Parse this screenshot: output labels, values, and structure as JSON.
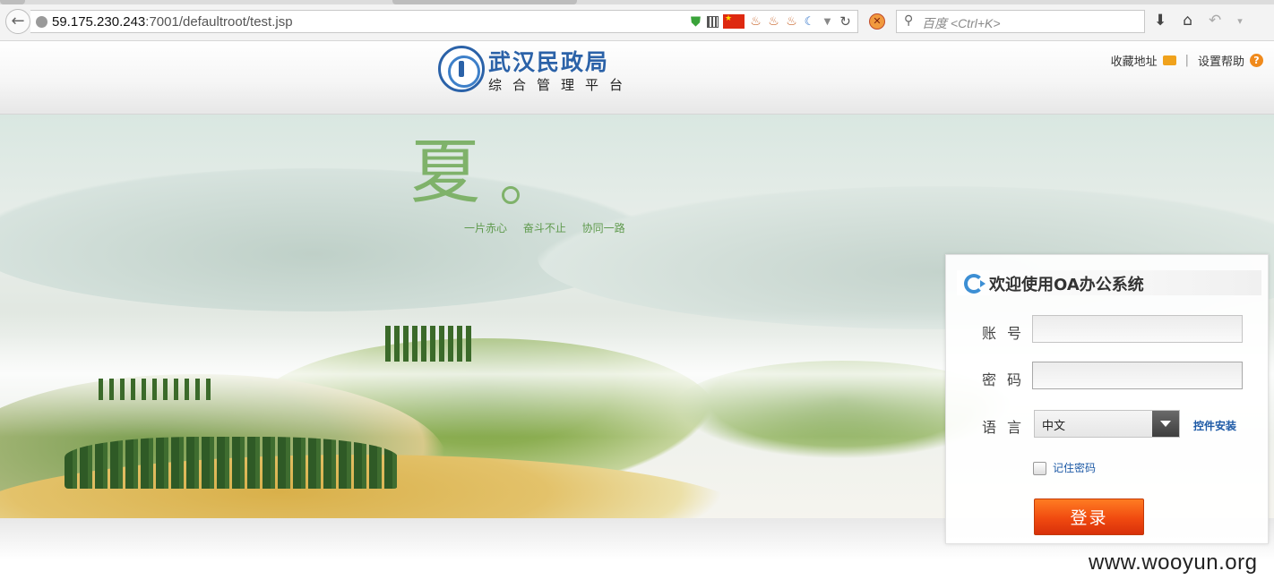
{
  "browser": {
    "url_host": "59.175.230.243",
    "url_rest": ":7001/defaultroot/test.jsp",
    "search_placeholder": "百度 <Ctrl+K>"
  },
  "header": {
    "org_title": "武汉民政局",
    "org_subtitle": "综合管理平台",
    "bookmark_label": "收藏地址",
    "separator": "|",
    "help_label": "设置帮助"
  },
  "banner": {
    "season_char": "夏",
    "slogan": "一片赤心 奋斗不止 协同一路"
  },
  "login": {
    "title": "欢迎使用OA办公系统",
    "account_label": "账号",
    "account_value": "",
    "password_label": "密码",
    "password_value": "",
    "language_label": "语言",
    "language_selected": "中文",
    "install_link": "控件安装",
    "remember_label": "记住密码",
    "remember_checked": false,
    "submit_label": "登录"
  },
  "watermark": "www.wooyun.org",
  "colors": {
    "brand_blue": "#2b62a8",
    "button_orange": "#f04a10",
    "link_blue": "#1e5aa6",
    "slogan_green": "#5f9a4d"
  }
}
